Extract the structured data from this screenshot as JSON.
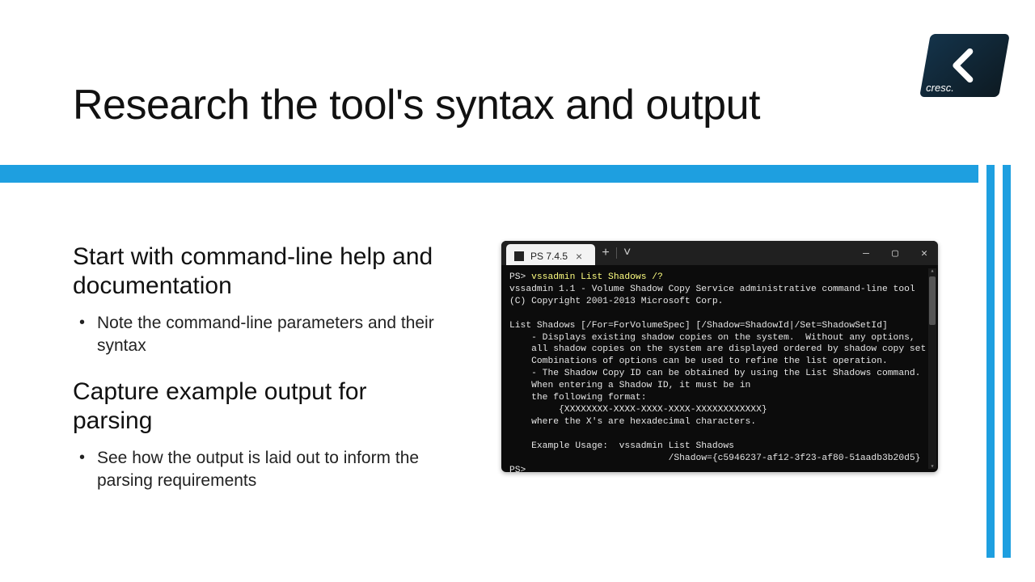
{
  "title": "Research the tool's syntax and output",
  "logo_text": "cresc.",
  "sections": [
    {
      "heading": "Start with command-line help and documentation",
      "bullets": [
        "Note the command-line parameters and their syntax"
      ]
    },
    {
      "heading": "Capture example output for parsing",
      "bullets": [
        "See how the output is laid out to inform the parsing requirements"
      ]
    }
  ],
  "terminal": {
    "tab_title": "PS 7.4.5",
    "prompt": "PS>",
    "command": "vssadmin List Shadows /?",
    "lines": [
      "vssadmin 1.1 - Volume Shadow Copy Service administrative command-line tool",
      "(C) Copyright 2001-2013 Microsoft Corp.",
      "",
      "List Shadows [/For=ForVolumeSpec] [/Shadow=ShadowId|/Set=ShadowSetId]",
      "    - Displays existing shadow copies on the system.  Without any options,",
      "    all shadow copies on the system are displayed ordered by shadow copy set.",
      "    Combinations of options can be used to refine the list operation.",
      "    - The Shadow Copy ID can be obtained by using the List Shadows command.",
      "    When entering a Shadow ID, it must be in",
      "    the following format:",
      "         {XXXXXXXX-XXXX-XXXX-XXXX-XXXXXXXXXXXX}",
      "    where the X's are hexadecimal characters.",
      "",
      "    Example Usage:  vssadmin List Shadows",
      "                             /Shadow={c5946237-af12-3f23-af80-51aadb3b20d5}"
    ],
    "end_prompt": "PS>"
  },
  "window_controls": {
    "minimize": "—",
    "maximize": "▢",
    "close": "✕"
  },
  "new_tab": {
    "plus": "+",
    "chevron": "˅"
  }
}
